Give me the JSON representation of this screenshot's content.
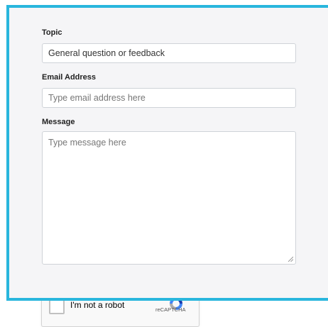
{
  "form": {
    "topic_label": "Topic",
    "topic_value": "General question or feedback",
    "email_label": "Email Address",
    "email_placeholder": "Type email address here",
    "message_label": "Message",
    "message_placeholder": "Type message here"
  },
  "captcha": {
    "checkbox_label": "I'm not a robot",
    "brand": "reCAPTCHA"
  },
  "colors": {
    "frame_border": "#29b6dd",
    "panel_bg": "#f5f5f7"
  }
}
